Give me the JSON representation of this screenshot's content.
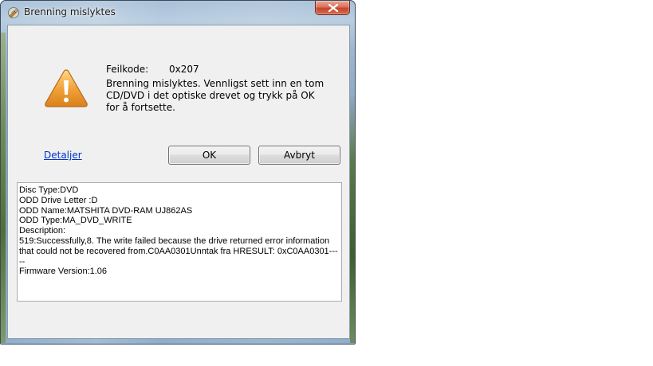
{
  "window": {
    "title": "Brenning mislyktes"
  },
  "dialog": {
    "error_code_label": "Feilkode:",
    "error_code_value": "0x207",
    "message": "Brenning mislyktes. Vennligst sett inn en tom CD/DVD i det optiske drevet og trykk på OK for å fortsette.",
    "details_link": "Detaljer",
    "ok_label": "OK",
    "cancel_label": "Avbryt",
    "details": [
      "Disc Type:DVD",
      "ODD Drive Letter :D",
      "ODD Name:MATSHITA DVD-RAM UJ862AS",
      "ODD Type:MA_DVD_WRITE",
      "Description:",
      "519:Successfully,8. The write failed because the drive returned error information that could not be recovered from.C0AA0301Unntak fra HRESULT: 0xC0AA0301-----",
      "Firmware Version:1.06"
    ]
  },
  "icons": {
    "app_icon": "app-icon",
    "close_icon": "close-icon",
    "warning_icon": "warning-icon"
  },
  "colors": {
    "link": "#0033cc",
    "close_button": "#c7452a",
    "warning_fill": "#f2a33a"
  }
}
